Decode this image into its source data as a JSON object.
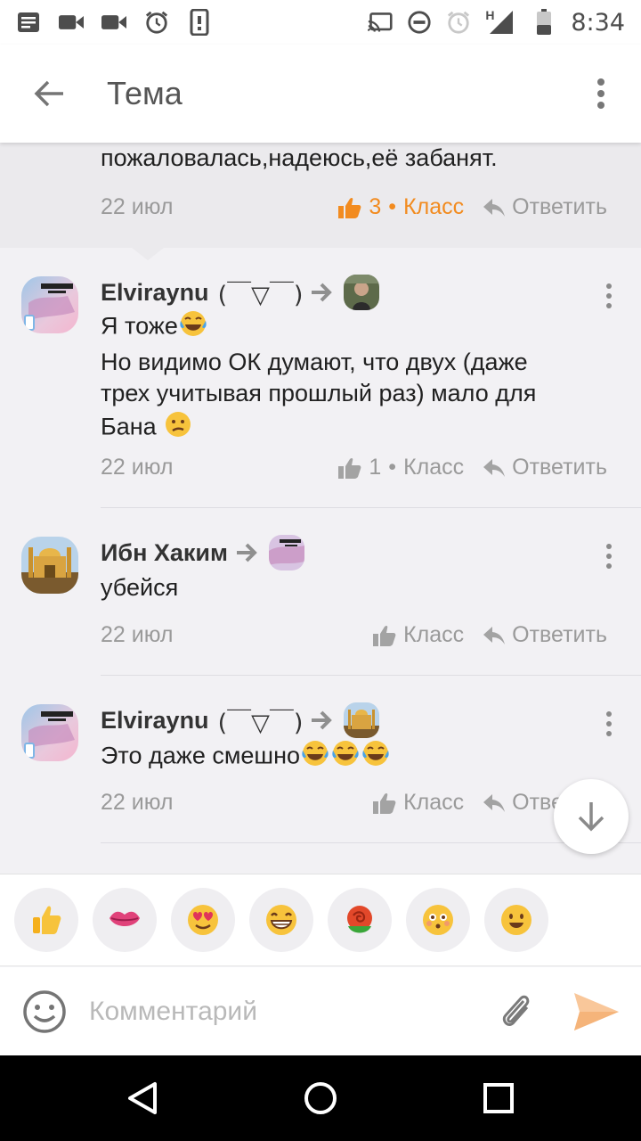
{
  "status_bar": {
    "time": "8:34",
    "network_label": "H",
    "left_icons": [
      "notes-icon",
      "video-icon",
      "video-icon",
      "alarm-icon",
      "phone-icon"
    ],
    "right_icons": [
      "cast-icon",
      "dnd-icon",
      "alarm-icon",
      "signal-icon",
      "battery-icon"
    ]
  },
  "app_bar": {
    "title": "Тема"
  },
  "quoted_comment": {
    "text": "пожаловалась,надеюсь,её забанят.",
    "date": "22 июл",
    "likes": "3",
    "class_label": "Класс",
    "reply_label": "Ответить"
  },
  "comments": [
    {
      "author": "Elviraynu",
      "kaomoji": "(￣▽￣)",
      "line1": "Я тоже",
      "line2": "Но видимо ОК думают, что двух (даже",
      "line3": "трех учитывая прошлый раз) мало для",
      "line4": "Бана",
      "date": "22 июл",
      "likes": "1",
      "class_label": "Класс",
      "reply_label": "Ответить"
    },
    {
      "author": "Ибн Хаким",
      "text": "убейся",
      "date": "22 июл",
      "class_label": "Класс",
      "reply_label": "Ответить"
    },
    {
      "author": "Elviraynu",
      "kaomoji": "(￣▽￣)",
      "text": "Это даже смешно",
      "date": "22 июл",
      "class_label": "Класс",
      "reply_label": "Ответить"
    }
  ],
  "stickers": [
    "thumbs-up-sticker",
    "kiss-lips-sticker",
    "heart-eyes-sticker",
    "grin-sticker",
    "rose-sticker",
    "blush-sticker",
    "smile-sticker"
  ],
  "input": {
    "placeholder": "Комментарий",
    "value": ""
  },
  "colors": {
    "accent": "#f28b1f",
    "meta_gray": "#9a9a9a",
    "feed_bg": "#f2f1f4"
  }
}
